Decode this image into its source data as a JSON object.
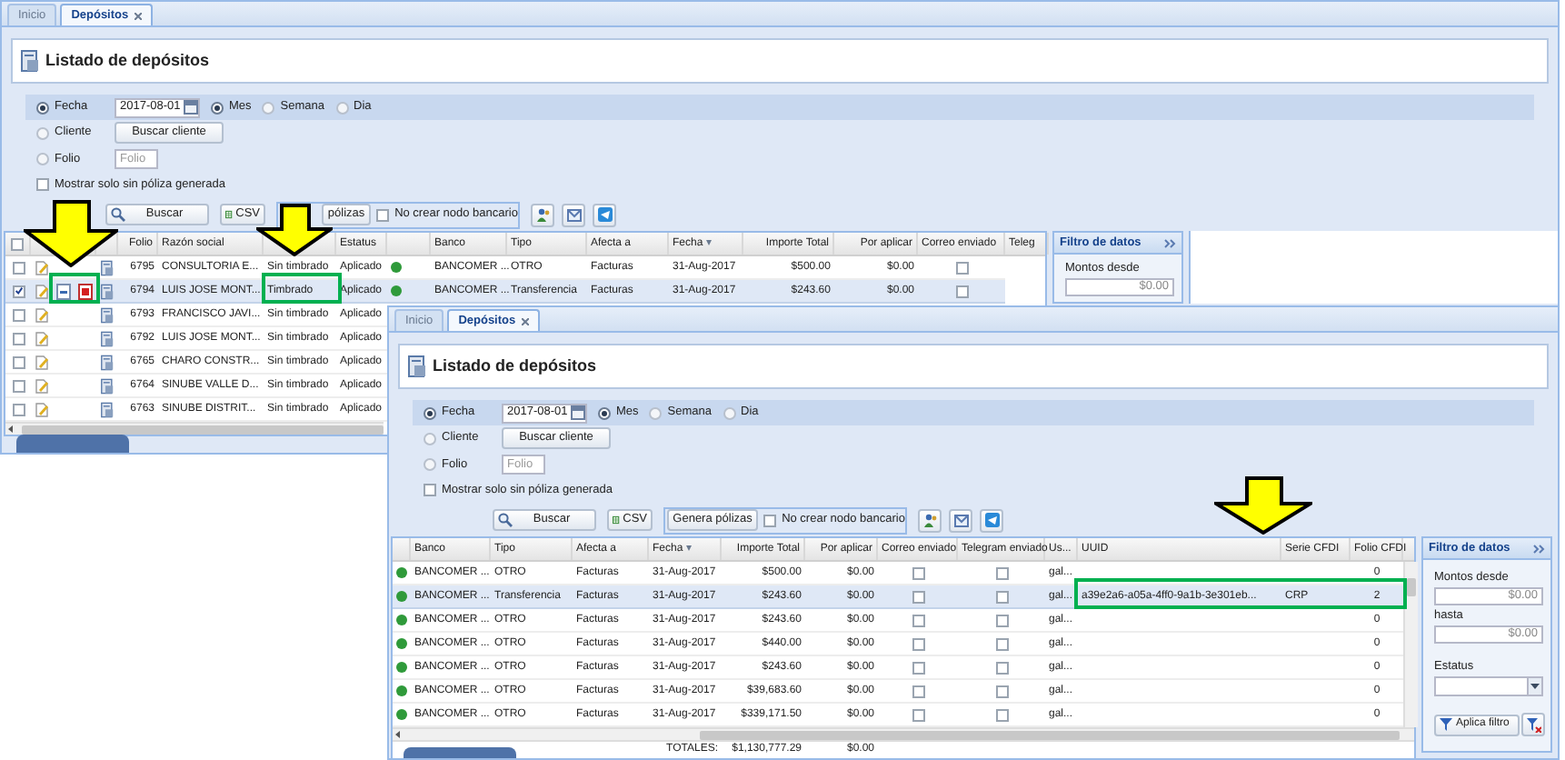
{
  "windows": [
    {
      "tabs": [
        {
          "label": "Inicio",
          "selected": false,
          "closable": false
        },
        {
          "label": "Depósitos",
          "selected": true,
          "closable": true
        }
      ],
      "title": "Listado de depósitos",
      "date_mode": {
        "label": "Fecha",
        "selected": true
      },
      "date": "2017-08-01",
      "periods": [
        {
          "label": "Mes",
          "selected": true
        },
        {
          "label": "Semana",
          "selected": false
        },
        {
          "label": "Dia",
          "selected": false
        }
      ],
      "client": {
        "label": "Cliente",
        "selected": false,
        "button": "Buscar cliente"
      },
      "folio": {
        "label": "Folio",
        "selected": false,
        "placeholder": "Folio"
      },
      "unposted_only": {
        "label": "Mostrar solo sin póliza generada",
        "checked": false
      },
      "toolbar": {
        "search": "Buscar",
        "csv": "CSV",
        "generate": "pólizas",
        "no_bank_node": {
          "label": "No crear nodo bancario",
          "checked": false
        }
      },
      "table": {
        "columns": [
          {
            "kind": "check",
            "checked": false
          },
          {
            "kind": "blank"
          },
          {
            "kind": "blank"
          },
          {
            "kind": "blank"
          },
          {
            "label": "Folio"
          },
          {
            "label": "Razón social"
          },
          {
            "kind": "blank"
          },
          {
            "label": "Estatus"
          },
          {
            "kind": "blank"
          },
          {
            "label": "Banco"
          },
          {
            "label": "Tipo"
          },
          {
            "label": "Afecta a"
          },
          {
            "label": "Fecha",
            "sort": "▾"
          },
          {
            "label": "Importe Total"
          },
          {
            "label": "Por aplicar"
          },
          {
            "label": "Correo enviado"
          },
          {
            "label": "Teleg"
          }
        ],
        "rows": [
          {
            "selected": false,
            "cells": [
              {
                "kind": "check",
                "checked": false
              },
              {
                "kind": "edit"
              },
              {
                "kind": "empty"
              },
              {
                "kind": "voucher"
              },
              "6795",
              "CONSULTORIA E...",
              "Sin timbrado",
              "Aplicado",
              {
                "kind": "dot",
                "color": "#2f9a3a"
              },
              "BANCOMER ...",
              "OTRO",
              "Facturas",
              "31-Aug-2017",
              "$500.00",
              "$0.00",
              {
                "kind": "check",
                "checked": false
              }
            ]
          },
          {
            "selected": true,
            "cells": [
              {
                "kind": "check",
                "checked": true
              },
              {
                "kind": "edit"
              },
              {
                "kind": "files"
              },
              {
                "kind": "voucher"
              },
              "6794",
              "LUIS JOSE MONT...",
              "Timbrado",
              "Aplicado",
              {
                "kind": "dot",
                "color": "#2f9a3a"
              },
              "BANCOMER ...",
              "Transferencia",
              "Facturas",
              "31-Aug-2017",
              "$243.60",
              "$0.00",
              {
                "kind": "check",
                "checked": false
              }
            ]
          },
          {
            "selected": false,
            "cells": [
              {
                "kind": "check",
                "checked": false
              },
              {
                "kind": "edit"
              },
              {
                "kind": "empty"
              },
              {
                "kind": "voucher"
              },
              "6793",
              "FRANCISCO JAVI...",
              "Sin timbrado",
              "Aplicado"
            ]
          },
          {
            "selected": false,
            "cells": [
              {
                "kind": "check",
                "checked": false
              },
              {
                "kind": "edit"
              },
              {
                "kind": "empty"
              },
              {
                "kind": "voucher"
              },
              "6792",
              "LUIS JOSE MONT...",
              "Sin timbrado",
              "Aplicado"
            ]
          },
          {
            "selected": false,
            "cells": [
              {
                "kind": "check",
                "checked": false
              },
              {
                "kind": "edit"
              },
              {
                "kind": "empty"
              },
              {
                "kind": "voucher"
              },
              "6765",
              "CHARO CONSTR...",
              "Sin timbrado",
              "Aplicado"
            ]
          },
          {
            "selected": false,
            "cells": [
              {
                "kind": "check",
                "checked": false
              },
              {
                "kind": "edit"
              },
              {
                "kind": "empty"
              },
              {
                "kind": "voucher"
              },
              "6764",
              "SINUBE VALLE D...",
              "Sin timbrado",
              "Aplicado"
            ]
          },
          {
            "selected": false,
            "cells": [
              {
                "kind": "check",
                "checked": false
              },
              {
                "kind": "edit"
              },
              {
                "kind": "empty"
              },
              {
                "kind": "voucher"
              },
              "6763",
              "SINUBE DISTRIT...",
              "Sin timbrado",
              "Aplicado"
            ]
          }
        ]
      },
      "filter": {
        "title": "Filtro de datos",
        "fields": [
          {
            "kind": "label",
            "text": "Montos desde"
          },
          {
            "kind": "input",
            "value": "$0.00"
          }
        ]
      }
    },
    {
      "tabs": [
        {
          "label": "Inicio",
          "selected": false,
          "closable": false
        },
        {
          "label": "Depósitos",
          "selected": true,
          "closable": true
        }
      ],
      "title": "Listado de depósitos",
      "date_mode": {
        "label": "Fecha",
        "selected": true
      },
      "date": "2017-08-01",
      "periods": [
        {
          "label": "Mes",
          "selected": true
        },
        {
          "label": "Semana",
          "selected": false
        },
        {
          "label": "Dia",
          "selected": false
        }
      ],
      "client": {
        "label": "Cliente",
        "selected": false,
        "button": "Buscar cliente"
      },
      "folio": {
        "label": "Folio",
        "selected": false,
        "placeholder": "Folio"
      },
      "unposted_only": {
        "label": "Mostrar solo sin póliza generada",
        "checked": false
      },
      "toolbar": {
        "search": "Buscar",
        "csv": "CSV",
        "generate": "Genera pólizas",
        "no_bank_node": {
          "label": "No crear nodo bancario",
          "checked": false
        }
      },
      "table": {
        "columns": [
          {
            "kind": "blank"
          },
          {
            "label": "Banco"
          },
          {
            "label": "Tipo"
          },
          {
            "label": "Afecta a"
          },
          {
            "label": "Fecha",
            "sort": "▾"
          },
          {
            "label": "Importe Total"
          },
          {
            "label": "Por aplicar"
          },
          {
            "label": "Correo enviado"
          },
          {
            "label": "Telegram enviado"
          },
          {
            "label": "Us..."
          },
          {
            "label": "UUID"
          },
          {
            "label": "Serie CFDI"
          },
          {
            "label": "Folio CFDI"
          }
        ],
        "rows": [
          {
            "selected": false,
            "cells": [
              {
                "kind": "dot",
                "color": "#2f9a3a"
              },
              "BANCOMER ...",
              "OTRO",
              "Facturas",
              "31-Aug-2017",
              "$500.00",
              "$0.00",
              {
                "kind": "check",
                "checked": false
              },
              {
                "kind": "check",
                "checked": false
              },
              "gal...",
              {
                "kind": "empty"
              },
              {
                "kind": "empty"
              },
              "0"
            ]
          },
          {
            "selected": true,
            "cells": [
              {
                "kind": "dot",
                "color": "#2f9a3a"
              },
              "BANCOMER ...",
              "Transferencia",
              "Facturas",
              "31-Aug-2017",
              "$243.60",
              "$0.00",
              {
                "kind": "check",
                "checked": false
              },
              {
                "kind": "check",
                "checked": false
              },
              "gal...",
              "a39e2a6-a05a-4ff0-9a1b-3e301eb...",
              "CRP",
              "2"
            ]
          },
          {
            "selected": false,
            "cells": [
              {
                "kind": "dot",
                "color": "#2f9a3a"
              },
              "BANCOMER ...",
              "OTRO",
              "Facturas",
              "31-Aug-2017",
              "$243.60",
              "$0.00",
              {
                "kind": "check",
                "checked": false
              },
              {
                "kind": "check",
                "checked": false
              },
              "gal...",
              {
                "kind": "empty"
              },
              {
                "kind": "empty"
              },
              "0"
            ]
          },
          {
            "selected": false,
            "cells": [
              {
                "kind": "dot",
                "color": "#2f9a3a"
              },
              "BANCOMER ...",
              "OTRO",
              "Facturas",
              "31-Aug-2017",
              "$440.00",
              "$0.00",
              {
                "kind": "check",
                "checked": false
              },
              {
                "kind": "check",
                "checked": false
              },
              "gal...",
              {
                "kind": "empty"
              },
              {
                "kind": "empty"
              },
              "0"
            ]
          },
          {
            "selected": false,
            "cells": [
              {
                "kind": "dot",
                "color": "#2f9a3a"
              },
              "BANCOMER ...",
              "OTRO",
              "Facturas",
              "31-Aug-2017",
              "$243.60",
              "$0.00",
              {
                "kind": "check",
                "checked": false
              },
              {
                "kind": "check",
                "checked": false
              },
              "gal...",
              {
                "kind": "empty"
              },
              {
                "kind": "empty"
              },
              "0"
            ]
          },
          {
            "selected": false,
            "cells": [
              {
                "kind": "dot",
                "color": "#2f9a3a"
              },
              "BANCOMER ...",
              "OTRO",
              "Facturas",
              "31-Aug-2017",
              "$39,683.60",
              "$0.00",
              {
                "kind": "check",
                "checked": false
              },
              {
                "kind": "check",
                "checked": false
              },
              "gal...",
              {
                "kind": "empty"
              },
              {
                "kind": "empty"
              },
              "0"
            ]
          },
          {
            "selected": false,
            "cells": [
              {
                "kind": "dot",
                "color": "#2f9a3a"
              },
              "BANCOMER ...",
              "OTRO",
              "Facturas",
              "31-Aug-2017",
              "$339,171.50",
              "$0.00",
              {
                "kind": "check",
                "checked": false
              },
              {
                "kind": "check",
                "checked": false
              },
              "gal...",
              {
                "kind": "empty"
              },
              {
                "kind": "empty"
              },
              "0"
            ]
          }
        ]
      },
      "totals": {
        "label": "TOTALES:",
        "values": [
          "$1,130,777.29",
          "$0.00"
        ]
      },
      "filter": {
        "title": "Filtro de datos",
        "fields": [
          {
            "kind": "label",
            "text": "Montos desde"
          },
          {
            "kind": "input",
            "value": "$0.00"
          },
          {
            "kind": "label",
            "text": "hasta"
          },
          {
            "kind": "input",
            "value": "$0.00"
          },
          {
            "kind": "label",
            "text": "Estatus"
          },
          {
            "kind": "select"
          },
          {
            "kind": "button",
            "text": "Aplica filtro"
          }
        ]
      }
    }
  ],
  "annotations": [
    {
      "kind": "arrow"
    },
    {
      "kind": "arrow"
    },
    {
      "kind": "arrow"
    },
    {
      "kind": "highlight"
    },
    {
      "kind": "highlight"
    },
    {
      "kind": "highlight"
    }
  ]
}
